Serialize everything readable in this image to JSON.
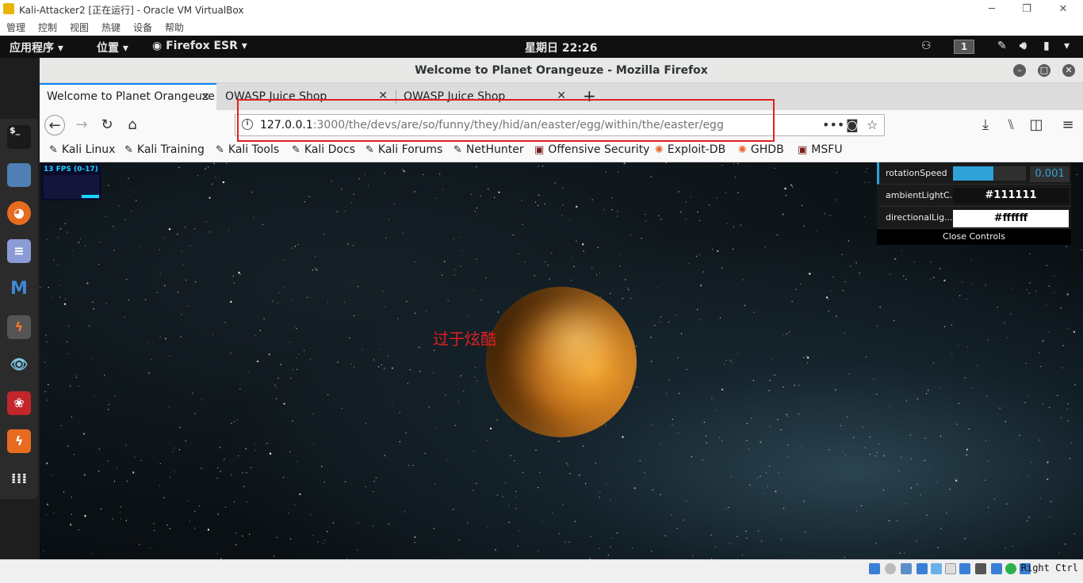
{
  "vbox": {
    "title": "Kali-Attacker2 [正在运行] - Oracle VM VirtualBox",
    "menu": [
      "管理",
      "控制",
      "视图",
      "热键",
      "设备",
      "帮助"
    ],
    "host_key": "Right Ctrl"
  },
  "kali_topbar": {
    "applications": "应用程序",
    "places": "位置",
    "app_name": "Firefox ESR",
    "clock": "星期日 22:26",
    "workspace": "1"
  },
  "dock": {
    "items": [
      "terminal-icon",
      "files-icon",
      "firefox-icon",
      "text-editor-icon",
      "metasploit-icon",
      "burpsuite-icon",
      "eye-icon",
      "cherrytree-icon",
      "faraday-icon",
      "app-grid-icon"
    ]
  },
  "firefox": {
    "window_title": "Welcome to Planet Orangeuze - Mozilla Firefox",
    "tabs": [
      {
        "label": "Welcome to Planet Orangeuze"
      },
      {
        "label": "OWASP Juice Shop"
      },
      {
        "label": "OWASP Juice Shop"
      }
    ],
    "url_host": "127.0.0.1",
    "url_rest": ":3000/the/devs/are/so/funny/they/hid/an/easter/egg/within/the/easter/egg",
    "bookmarks": [
      "Kali Linux",
      "Kali Training",
      "Kali Tools",
      "Kali Docs",
      "Kali Forums",
      "NetHunter",
      "Offensive Security",
      "Exploit-DB",
      "GHDB",
      "MSFU"
    ]
  },
  "page": {
    "fps_label": "13 FPS (0-17)",
    "annotation": "过于炫酷",
    "controls": {
      "rotation_label": "rotationSpeed",
      "rotation_value": "0.001",
      "rotation_fill": 0.55,
      "ambient_label": "ambientLightC...",
      "ambient_value": "#111111",
      "directional_label": "directionalLig...",
      "directional_value": "#ffffff",
      "close_label": "Close Controls"
    }
  },
  "colors": {
    "accent": "#0a84ff",
    "annotation_red": "#e02020",
    "planet": "#c7731a",
    "controls_bar": "#2fa1d6"
  }
}
